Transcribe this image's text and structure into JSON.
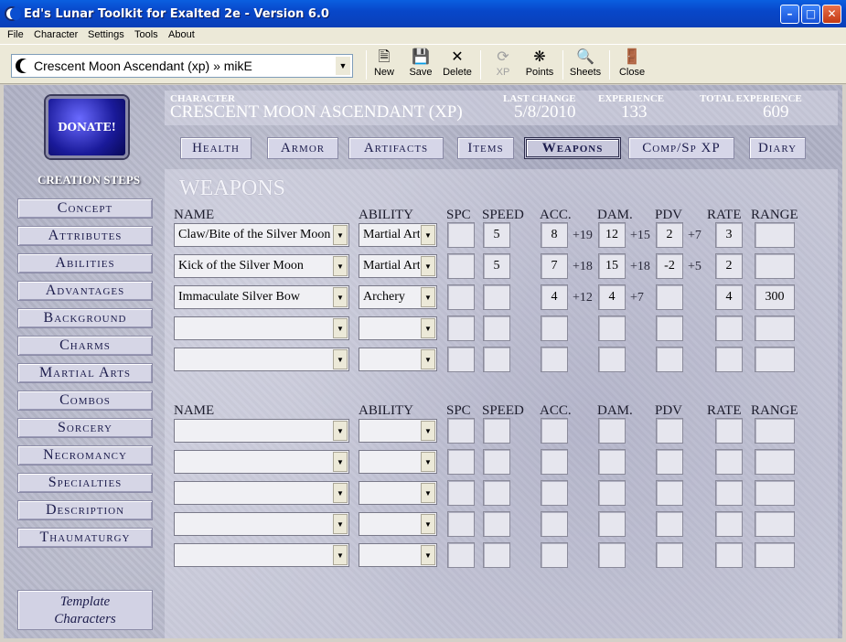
{
  "window": {
    "title": "Ed's Lunar Toolkit for Exalted 2e - Version 6.0",
    "minimize_icon": "minimize-icon",
    "maximize_icon": "maximize-icon",
    "close_icon": "close-icon"
  },
  "menu": [
    "File",
    "Character",
    "Settings",
    "Tools",
    "About"
  ],
  "toolbar": {
    "character": "Crescent Moon Ascendant (xp) » mikE",
    "new": "New",
    "save": "Save",
    "delete": "Delete",
    "xp": "XP",
    "points": "Points",
    "sheets": "Sheets",
    "close": "Close"
  },
  "donate": "DONATE!",
  "creation_steps": {
    "title": "CREATION STEPS",
    "items": [
      "Concept",
      "Attributes",
      "Abilities",
      "Advantages",
      "Background",
      "Charms",
      "Martial Arts",
      "Combos",
      "Sorcery",
      "Necromancy",
      "Specialties",
      "Description",
      "Thaumaturgy"
    ],
    "template_line1": "Template",
    "template_line2": "Characters"
  },
  "header": {
    "character_label": "CHARACTER",
    "character": "CRESCENT MOON ASCENDANT (XP)",
    "last_change_label": "LAST CHANGE",
    "last_change": "5/8/2010",
    "experience_label": "EXPERIENCE",
    "experience": "133",
    "total_experience_label": "TOTAL EXPERIENCE",
    "total_experience": "609"
  },
  "tabs": [
    "Health",
    "Armor",
    "Artifacts",
    "Items",
    "Weapons",
    "Comp/Sp XP",
    "Diary"
  ],
  "active_tab": "Weapons",
  "panel": {
    "title": "WEAPONS"
  },
  "columns": {
    "name": "NAME",
    "ability": "ABILITY",
    "spc": "SPC",
    "speed": "SPEED",
    "acc": "ACC.",
    "dam": "DAM.",
    "pdv": "PDV",
    "rate": "RATE",
    "range": "RANGE"
  },
  "melee_rows": [
    {
      "name": "Claw/Bite of the Silver Moon",
      "ability": "Martial Arts",
      "spc": "",
      "speed": "5",
      "acc": "8",
      "acc_bonus": "+19",
      "dam": "12",
      "dam_bonus": "+15",
      "pdv": "2",
      "pdv_bonus": "+7",
      "rate": "3",
      "range": ""
    },
    {
      "name": "Kick of the Silver Moon",
      "ability": "Martial Arts",
      "spc": "",
      "speed": "5",
      "acc": "7",
      "acc_bonus": "+18",
      "dam": "15",
      "dam_bonus": "+18",
      "pdv": "-2",
      "pdv_bonus": "+5",
      "rate": "2",
      "range": ""
    },
    {
      "name": "Immaculate Silver Bow",
      "ability": "Archery",
      "spc": "",
      "speed": "",
      "acc": "4",
      "acc_bonus": "+12",
      "dam": "4",
      "dam_bonus": "+7",
      "pdv": "",
      "pdv_bonus": "",
      "rate": "4",
      "range": "300"
    },
    {
      "name": "",
      "ability": "",
      "spc": "",
      "speed": "",
      "acc": "",
      "acc_bonus": "",
      "dam": "",
      "dam_bonus": "",
      "pdv": "",
      "pdv_bonus": "",
      "rate": "",
      "range": ""
    },
    {
      "name": "",
      "ability": "",
      "spc": "",
      "speed": "",
      "acc": "",
      "acc_bonus": "",
      "dam": "",
      "dam_bonus": "",
      "pdv": "",
      "pdv_bonus": "",
      "rate": "",
      "range": ""
    }
  ],
  "ranged_rows": [
    {
      "name": "",
      "ability": "",
      "spc": "",
      "speed": "",
      "acc": "",
      "acc_bonus": "",
      "dam": "",
      "dam_bonus": "",
      "pdv": "",
      "pdv_bonus": "",
      "rate": "",
      "range": ""
    },
    {
      "name": "",
      "ability": "",
      "spc": "",
      "speed": "",
      "acc": "",
      "acc_bonus": "",
      "dam": "",
      "dam_bonus": "",
      "pdv": "",
      "pdv_bonus": "",
      "rate": "",
      "range": ""
    },
    {
      "name": "",
      "ability": "",
      "spc": "",
      "speed": "",
      "acc": "",
      "acc_bonus": "",
      "dam": "",
      "dam_bonus": "",
      "pdv": "",
      "pdv_bonus": "",
      "rate": "",
      "range": ""
    },
    {
      "name": "",
      "ability": "",
      "spc": "",
      "speed": "",
      "acc": "",
      "acc_bonus": "",
      "dam": "",
      "dam_bonus": "",
      "pdv": "",
      "pdv_bonus": "",
      "rate": "",
      "range": ""
    },
    {
      "name": "",
      "ability": "",
      "spc": "",
      "speed": "",
      "acc": "",
      "acc_bonus": "",
      "dam": "",
      "dam_bonus": "",
      "pdv": "",
      "pdv_bonus": "",
      "rate": "",
      "range": ""
    }
  ]
}
